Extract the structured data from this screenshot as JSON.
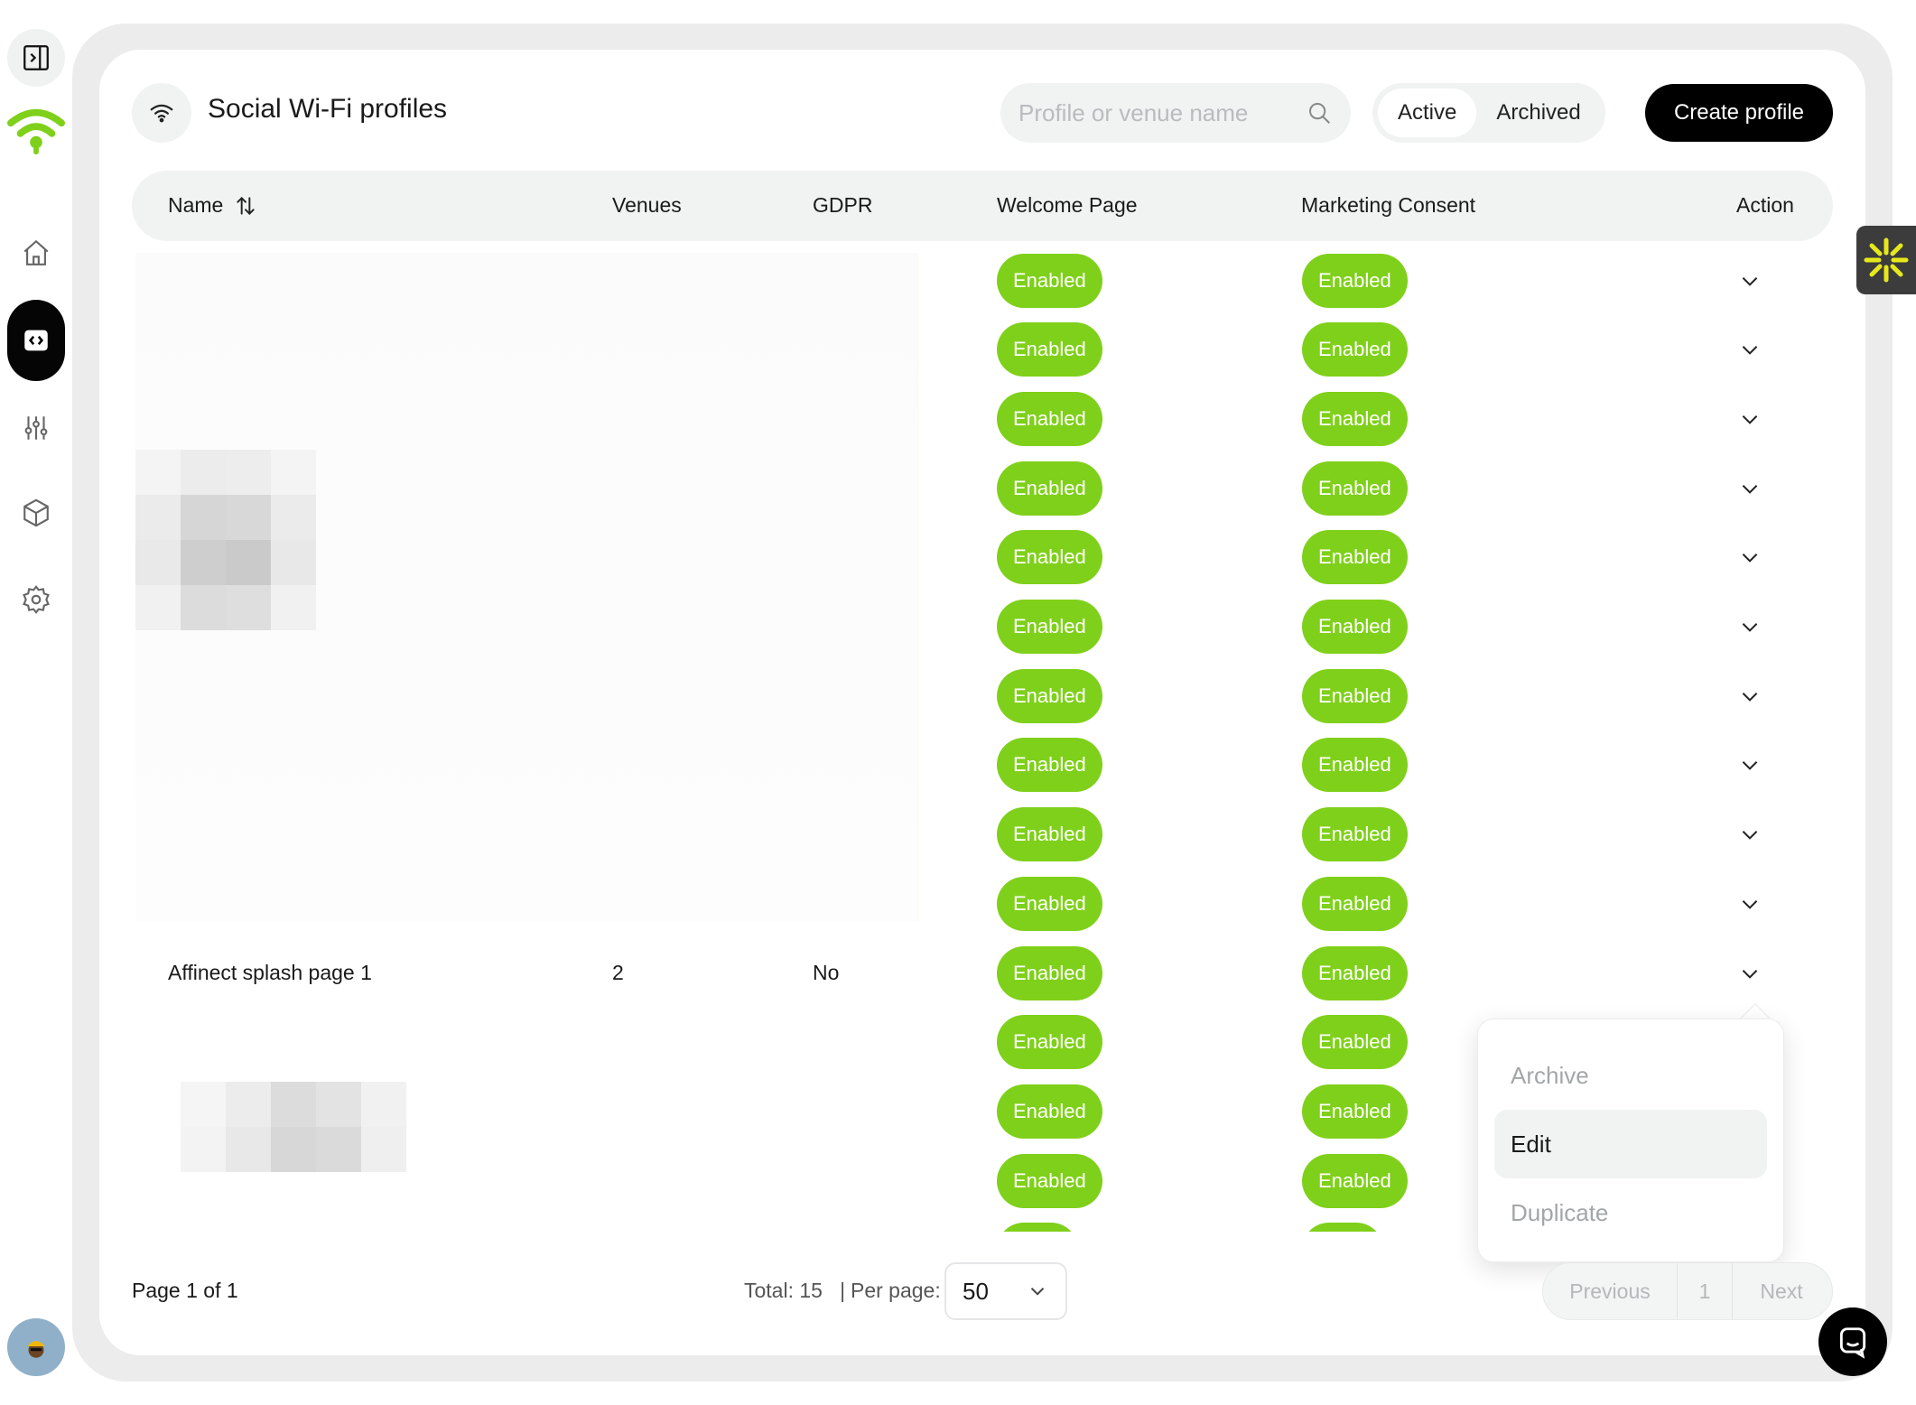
{
  "header": {
    "title": "Social Wi-Fi profiles",
    "search_placeholder": "Profile or venue name",
    "status_tabs": [
      "Active",
      "Archived"
    ],
    "selected_status": "Active",
    "create_label": "Create profile"
  },
  "table": {
    "columns": [
      "Name",
      "Venues",
      "GDPR",
      "Welcome Page",
      "Marketing Consent",
      "Action"
    ],
    "rows": [
      {
        "name": "",
        "venues": "",
        "gdpr": "",
        "welcome": "Enabled",
        "marketing": "Enabled"
      },
      {
        "name": "",
        "venues": "",
        "gdpr": "",
        "welcome": "Enabled",
        "marketing": "Enabled"
      },
      {
        "name": "",
        "venues": "",
        "gdpr": "",
        "welcome": "Enabled",
        "marketing": "Enabled"
      },
      {
        "name": "",
        "venues": "",
        "gdpr": "",
        "welcome": "Enabled",
        "marketing": "Enabled"
      },
      {
        "name": "",
        "venues": "",
        "gdpr": "",
        "welcome": "Enabled",
        "marketing": "Enabled"
      },
      {
        "name": "",
        "venues": "",
        "gdpr": "",
        "welcome": "Enabled",
        "marketing": "Enabled"
      },
      {
        "name": "",
        "venues": "",
        "gdpr": "",
        "welcome": "Enabled",
        "marketing": "Enabled"
      },
      {
        "name": "",
        "venues": "",
        "gdpr": "",
        "welcome": "Enabled",
        "marketing": "Enabled"
      },
      {
        "name": "",
        "venues": "",
        "gdpr": "",
        "welcome": "Enabled",
        "marketing": "Enabled"
      },
      {
        "name": "",
        "venues": "",
        "gdpr": "",
        "welcome": "Enabled",
        "marketing": "Enabled"
      },
      {
        "name": "Affinect splash page 1",
        "venues": "2",
        "gdpr": "No",
        "welcome": "Enabled",
        "marketing": "Enabled"
      },
      {
        "name": "",
        "venues": "",
        "gdpr": "",
        "welcome": "Enabled",
        "marketing": "Enabled"
      },
      {
        "name": "",
        "venues": "",
        "gdpr": "",
        "welcome": "Enabled",
        "marketing": "Enabled"
      },
      {
        "name": "",
        "venues": "",
        "gdpr": "",
        "welcome": "Enabled",
        "marketing": "Enabled"
      }
    ]
  },
  "action_menu": {
    "items": [
      "Archive",
      "Edit",
      "Duplicate"
    ],
    "highlighted": "Edit"
  },
  "footer": {
    "page_info": "Page 1 of 1",
    "total": "Total: 15",
    "separator": "|",
    "per_page_label": "Per page:",
    "per_page_value": "50",
    "previous_label": "Previous",
    "current_page": "1",
    "next_label": "Next"
  },
  "icons": {
    "rail": [
      "panel-toggle-icon",
      "wifi-logo-icon",
      "home-icon",
      "code-icon",
      "sliders-icon",
      "box-icon",
      "gear-icon"
    ],
    "badge_color": "#7fd01a"
  }
}
